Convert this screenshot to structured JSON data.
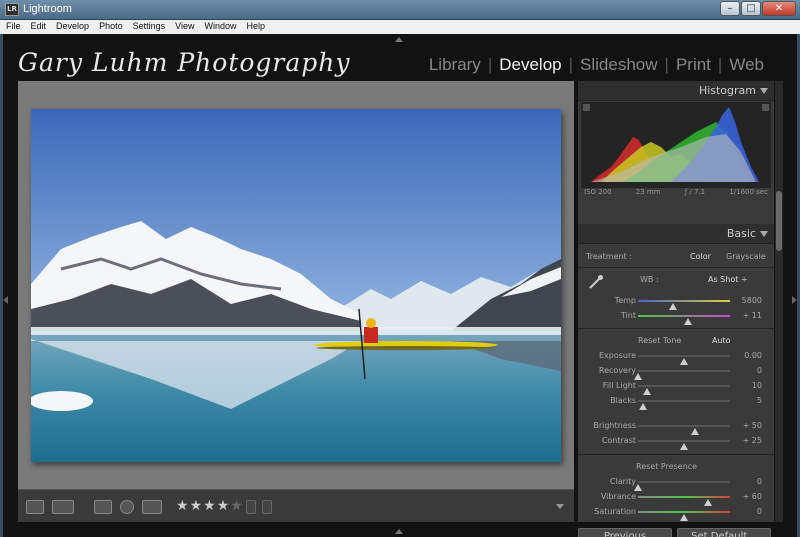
{
  "window": {
    "title": "Lightroom",
    "icon_text": "LR",
    "minimize": "–",
    "maximize": "□",
    "close": "✕"
  },
  "menu": [
    "File",
    "Edit",
    "Develop",
    "Photo",
    "Settings",
    "View",
    "Window",
    "Help"
  ],
  "identity_plate": "Gary Luhm Photography",
  "modules": [
    "Library",
    "Develop",
    "Slideshow",
    "Print",
    "Web"
  ],
  "active_module": "Develop",
  "histogram": {
    "title": "Histogram",
    "iso": "ISO 200",
    "focal": "23 mm",
    "aperture": "ƒ / 7.1",
    "shutter": "1/1600 sec"
  },
  "basic": {
    "title": "Basic",
    "treatment_label": "Treatment :",
    "treatment_color": "Color",
    "treatment_grayscale": "Grayscale",
    "wb_label": "WB :",
    "wb_value": "As Shot ÷",
    "temp": {
      "label": "Temp",
      "value": "5800",
      "pos": 0.38
    },
    "tint": {
      "label": "Tint",
      "value": "+ 11",
      "pos": 0.54
    },
    "reset_tone": "Reset Tone",
    "auto": "Auto",
    "exposure": {
      "label": "Exposure",
      "value": "0.00",
      "pos": 0.5
    },
    "recovery": {
      "label": "Recovery",
      "value": "0",
      "pos": 0.0
    },
    "fill_light": {
      "label": "Fill Light",
      "value": "10",
      "pos": 0.1
    },
    "blacks": {
      "label": "Blacks",
      "value": "5",
      "pos": 0.05
    },
    "brightness": {
      "label": "Brightness",
      "value": "+ 50",
      "pos": 0.62
    },
    "contrast": {
      "label": "Contrast",
      "value": "+ 25",
      "pos": 0.5
    },
    "reset_presence": "Reset Presence",
    "clarity": {
      "label": "Clarity",
      "value": "0",
      "pos": 0.0
    },
    "vibrance": {
      "label": "Vibrance",
      "value": "+ 60",
      "pos": 0.76
    },
    "saturation": {
      "label": "Saturation",
      "value": "0",
      "pos": 0.5
    }
  },
  "buttons": {
    "previous": "Previous",
    "set_default": "Set Default..."
  },
  "rating": {
    "stars": 4,
    "max": 5
  },
  "colors": {
    "sky_top": "#3f6fbf",
    "sky_bottom": "#b9d2ee",
    "water": "#2e7a98",
    "kayak": "#e8d200"
  }
}
